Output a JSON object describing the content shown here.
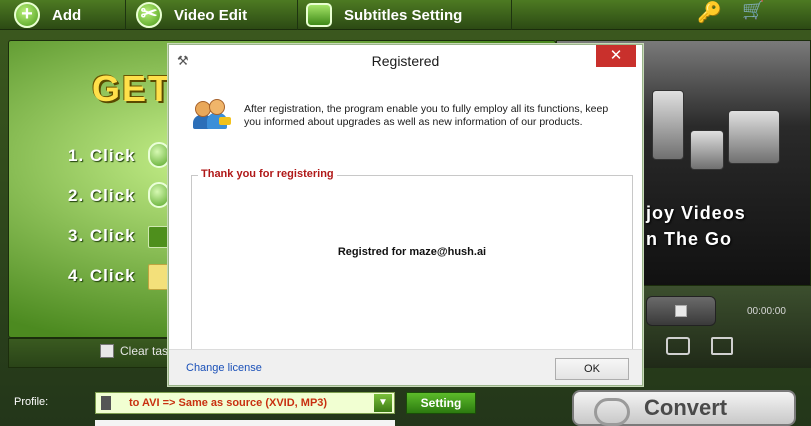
{
  "toolbar": {
    "add_label": "Add",
    "video_edit_label": "Video Edit",
    "subtitles_label": "Subtitles Setting"
  },
  "left_panel": {
    "title": "GET",
    "steps": [
      "1. Click",
      "2. Click",
      "3. Click",
      "4. Click"
    ]
  },
  "clear_task_label": "Clear tas",
  "right_panel": {
    "enjoy_line1": "joy Videos",
    "enjoy_line2": "n The Go",
    "time": "00:00:00"
  },
  "profile": {
    "label": "Profile:",
    "value": "to AVI => Same as source (XVID, MP3)",
    "setting_label": "Setting"
  },
  "convert_label": "Convert",
  "dialog": {
    "title": "Registered",
    "close_glyph": "✕",
    "description": "After registration, the program enable you to fully employ all its functions, keep you informed about upgrades as well as new information of our products.",
    "group_title": "Thank you for registering",
    "registered_text": "Registred for maze@hush.ai",
    "change_license": "Change license",
    "ok_label": "OK"
  },
  "icons": {
    "title_icon": "tools-icon",
    "users_icon": "users-key-icon"
  },
  "colors": {
    "accent_green": "#4e8f1c",
    "group_title_red": "#b01818",
    "link_blue": "#1a50b8",
    "close_red": "#c9302c"
  }
}
